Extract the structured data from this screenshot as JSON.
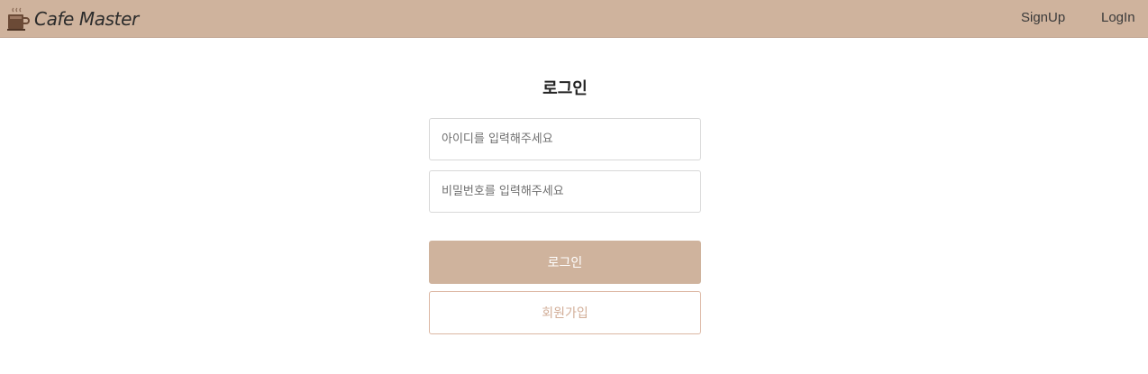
{
  "navbar": {
    "brand": "Cafe Master",
    "logo_icon": "coffee-cup-icon",
    "links": {
      "signup": "SignUp",
      "login": "LogIn"
    },
    "background": "#cfb39d"
  },
  "form": {
    "title": "로그인",
    "id_field": {
      "placeholder": "아이디를 입력해주세요",
      "value": ""
    },
    "password_field": {
      "placeholder": "비밀번호를 입력해주세요",
      "value": ""
    },
    "login_button": "로그인",
    "signup_button": "회원가입"
  },
  "colors": {
    "accent": "#cfb39d",
    "signup_text": "#d2ae98"
  }
}
